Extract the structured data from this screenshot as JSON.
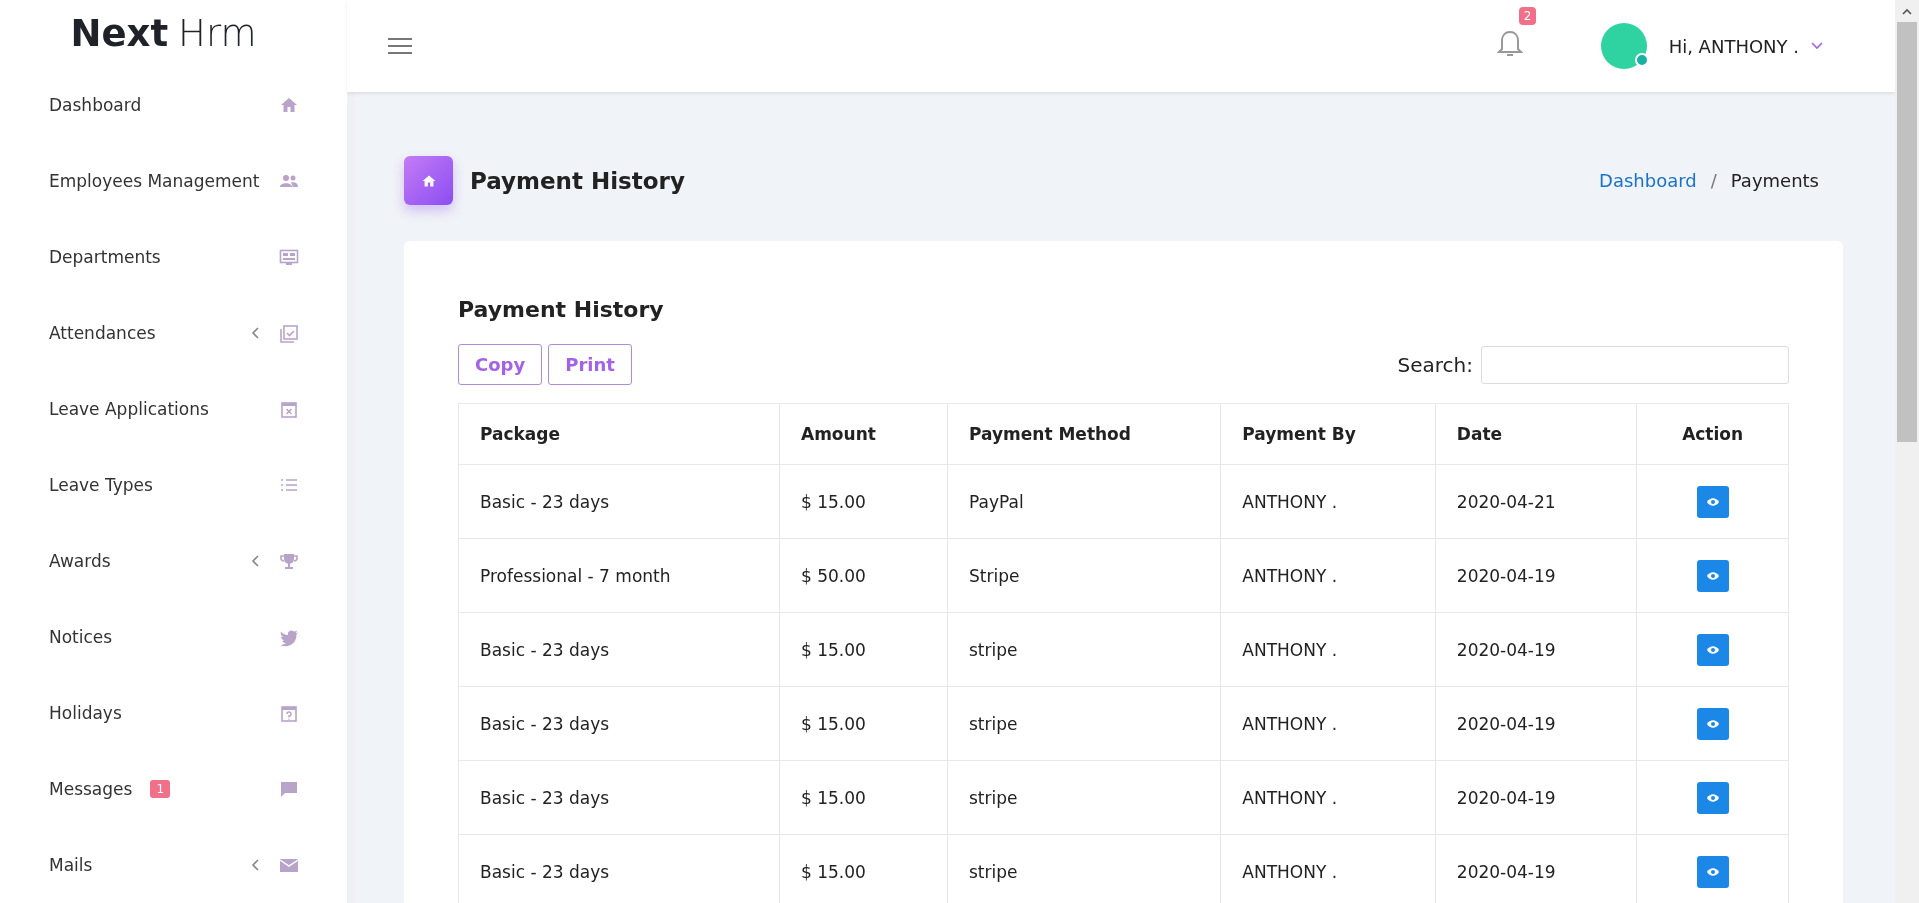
{
  "brand": {
    "bold": "Next",
    "light": "Hrm"
  },
  "sidebar": {
    "items": [
      {
        "label": "Dashboard",
        "submenu": false
      },
      {
        "label": "Employees Management",
        "submenu": false
      },
      {
        "label": "Departments",
        "submenu": false
      },
      {
        "label": "Attendances",
        "submenu": true
      },
      {
        "label": "Leave Applications",
        "submenu": false
      },
      {
        "label": "Leave Types",
        "submenu": false
      },
      {
        "label": "Awards",
        "submenu": true
      },
      {
        "label": "Notices",
        "submenu": false
      },
      {
        "label": "Holidays",
        "submenu": false
      },
      {
        "label": "Messages",
        "submenu": false,
        "badge": "1"
      },
      {
        "label": "Mails",
        "submenu": true
      }
    ]
  },
  "header": {
    "notifications": "2",
    "user": "Hi, ANTHONY ."
  },
  "page": {
    "title": "Payment History",
    "breadcrumb": [
      {
        "label": "Dashboard",
        "link": true
      },
      {
        "label": "Payments",
        "link": false
      }
    ],
    "breadcrumb_separator": "/"
  },
  "card": {
    "title": "Payment History",
    "buttons": [
      "Copy",
      "Print"
    ],
    "search_label": "Search:",
    "table": {
      "columns": [
        "Package",
        "Amount",
        "Payment Method",
        "Payment By",
        "Date",
        "Action"
      ],
      "rows": [
        [
          "Basic - 23 days",
          "$ 15.00",
          "PayPal",
          "ANTHONY .",
          "2020-04-21"
        ],
        [
          "Professional - 7 month",
          "$ 50.00",
          "Stripe",
          "ANTHONY .",
          "2020-04-19"
        ],
        [
          "Basic - 23 days",
          "$ 15.00",
          "stripe",
          "ANTHONY .",
          "2020-04-19"
        ],
        [
          "Basic - 23 days",
          "$ 15.00",
          "stripe",
          "ANTHONY .",
          "2020-04-19"
        ],
        [
          "Basic - 23 days",
          "$ 15.00",
          "stripe",
          "ANTHONY .",
          "2020-04-19"
        ],
        [
          "Basic - 23 days",
          "$ 15.00",
          "stripe",
          "ANTHONY .",
          "2020-04-19"
        ]
      ]
    }
  }
}
